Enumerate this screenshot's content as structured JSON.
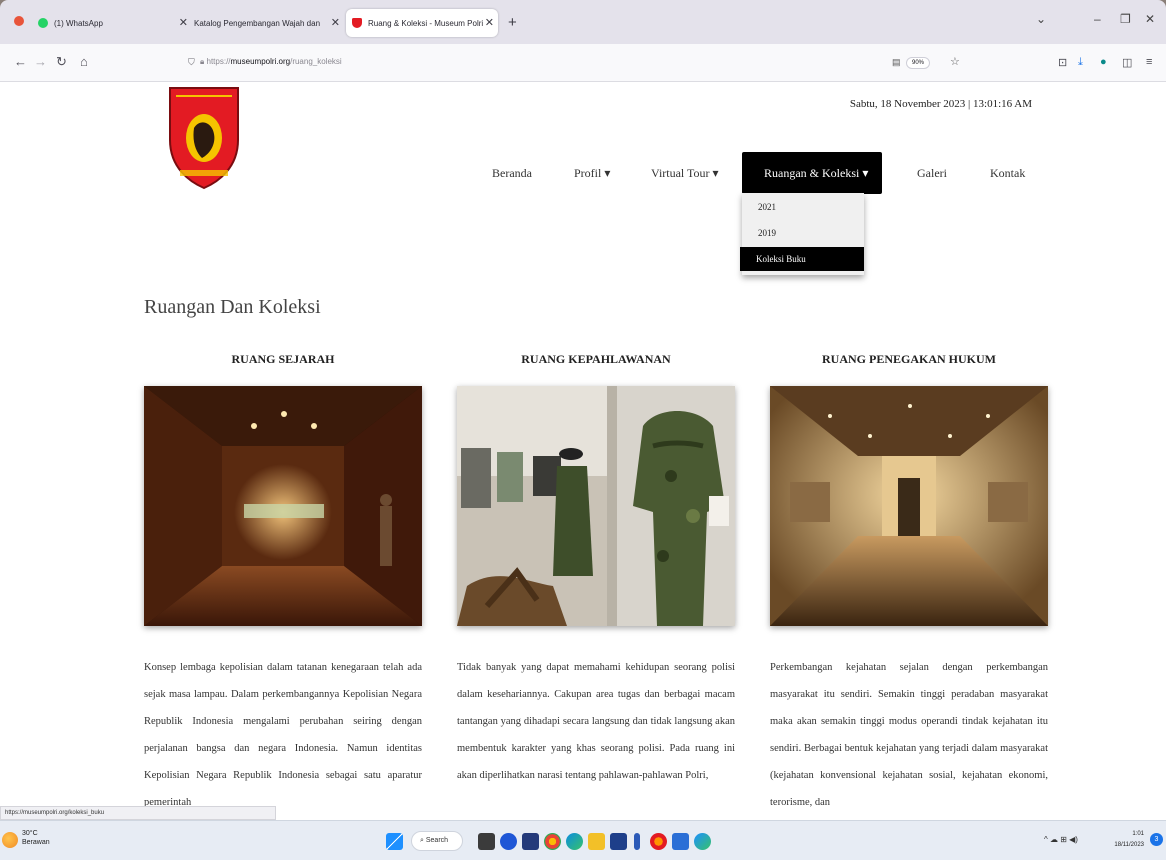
{
  "browser": {
    "tabs": [
      {
        "label": "(1) WhatsApp",
        "active": false
      },
      {
        "label": "Katalog Pengembangan Wajah dan",
        "active": false
      },
      {
        "label": "Ruang & Koleksi - Museum Polri",
        "active": true
      }
    ],
    "new_tab": "+",
    "window_controls": [
      "⌄",
      "–",
      "❐",
      "✕"
    ],
    "nav": {
      "back": "←",
      "forward": "→",
      "reload": "↻",
      "home": "⌂"
    },
    "url_prefix": "https://",
    "url_host": "museumpolri.org",
    "url_path": "/ruang_koleksi",
    "zoom": "90%",
    "status_url": "https://museumpolri.org/koleksi_buku"
  },
  "site": {
    "datetime": "Sabtu, 18 November 2023 | 13:01:16 AM",
    "menu": [
      {
        "label": "Beranda",
        "active": false
      },
      {
        "label": "Profil ▾",
        "active": false
      },
      {
        "label": "Virtual Tour ▾",
        "active": false
      },
      {
        "label": "Ruangan & Koleksi ▾",
        "active": true
      },
      {
        "label": "Galeri",
        "active": false
      },
      {
        "label": "Kontak",
        "active": false
      }
    ],
    "dropdown": [
      "2021",
      "2019",
      "Koleksi Buku"
    ],
    "section_title": "Ruangan Dan Koleksi",
    "columns": [
      {
        "title": "RUANG SEJARAH",
        "text": "Konsep lembaga kepolisian dalam tatanan kenegaraan telah ada sejak masa lampau. Dalam perkembangannya Kepolisian Negara Republik Indonesia mengalami perubahan seiring dengan perjalanan bangsa dan negara Indonesia. Namun identitas Kepolisian Negara Republik Indonesia sebagai satu aparatur pemerintah"
      },
      {
        "title": "RUANG KEPAHLAWANAN",
        "text": "Tidak banyak yang dapat memahami kehidupan seorang polisi dalam kesehariannya. Cakupan area tugas dan berbagai macam tantangan yang dihadapi secara langsung dan tidak langsung akan membentuk karakter yang khas seorang polisi. Pada ruang ini akan diperlihatkan narasi tentang pahlawan-pahlawan Polri,"
      },
      {
        "title": "RUANG PENEGAKAN HUKUM",
        "text": "Perkembangan kejahatan sejalan dengan perkembangan masyarakat itu sendiri. Semakin tinggi peradaban masyarakat maka akan semakin tinggi modus operandi tindak kejahatan itu sendiri. Berbagai bentuk kejahatan yang terjadi dalam masyarakat (kejahatan konvensional kejahatan sosial, kejahatan ekonomi, terorisme, dan"
      }
    ]
  },
  "taskbar": {
    "weather_temp": "30°C",
    "weather_desc": "Berawan",
    "search_label": "Search",
    "clock_time": "1:01",
    "clock_date": "18/11/2023",
    "notifications": "3",
    "tray": "^  ☁  ⊞  ◀)"
  },
  "colors": {
    "menu_active_bg": "#000000",
    "logo_red": "#e31b23",
    "logo_gold": "#f5c400"
  },
  "icons": {
    "tabs": [
      "whatsapp-icon",
      "document-icon",
      "police-emblem-icon"
    ],
    "taskbar": [
      "windows-start-icon",
      "search-icon",
      "file-explorer-icon",
      "edge-icon",
      "chrome-icon",
      "firefox-icon",
      "store-icon",
      "folder-icon",
      "word-icon",
      "settings-icon"
    ]
  }
}
